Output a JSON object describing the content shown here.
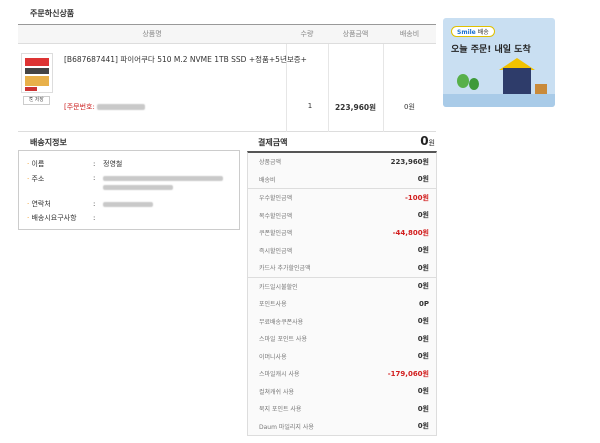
{
  "order": {
    "section_title": "주문하신상품",
    "headers": {
      "name": "상품명",
      "qty": "수량",
      "amount": "상품금액",
      "shipping": "배송비"
    },
    "product_name": "[B687687441] 파이어쿠다 510 M.2 NVME 1TB SSD +정품+5년보증+",
    "order_no_label": "[주문번호:",
    "qty": "1",
    "amount": "223,960원",
    "shipping_fee": "0원",
    "save_label": "저장"
  },
  "banner": {
    "badge_brand": "Smile",
    "badge_text": "배송",
    "headline": "오늘 주문! 내일 도착"
  },
  "shipping": {
    "section_title": "배송지정보",
    "rows": [
      {
        "label": "이름",
        "value": "정영철"
      },
      {
        "label": "주소",
        "value": ""
      },
      {
        "label": "연락처",
        "value": ""
      },
      {
        "label": "배송시요구사항",
        "value": ""
      }
    ]
  },
  "payment": {
    "section_title": "결제금액",
    "total": "0",
    "total_unit": "원",
    "groups": [
      [
        {
          "label": "상품금액",
          "value": "223,960원"
        },
        {
          "label": "배송비",
          "value": "0원"
        }
      ],
      [
        {
          "label": "우수할인금액",
          "value": "-100원"
        },
        {
          "label": "복수할인금액",
          "value": "0원"
        },
        {
          "label": "쿠폰할인금액",
          "value": "-44,800원"
        },
        {
          "label": "즉시할인금액",
          "value": "0원"
        },
        {
          "label": "카드사 추가할인금액",
          "value": "0원"
        }
      ],
      [
        {
          "label": "카드일시불할인",
          "value": "0원"
        },
        {
          "label": "포인트사용",
          "value": "0P"
        },
        {
          "label": "무료배송쿠폰사용",
          "value": "0원"
        },
        {
          "label": "스마일 포인트 사용",
          "value": "0원"
        },
        {
          "label": "이머니사용",
          "value": "0원"
        },
        {
          "label": "스마일캐시 사용",
          "value": "-179,060원"
        },
        {
          "label": "컬쳐캐쉬 사용",
          "value": "0원"
        },
        {
          "label": "북지 포인트 사용",
          "value": "0원"
        },
        {
          "label": "Daum 마일리지 사용",
          "value": "0원"
        }
      ]
    ]
  }
}
